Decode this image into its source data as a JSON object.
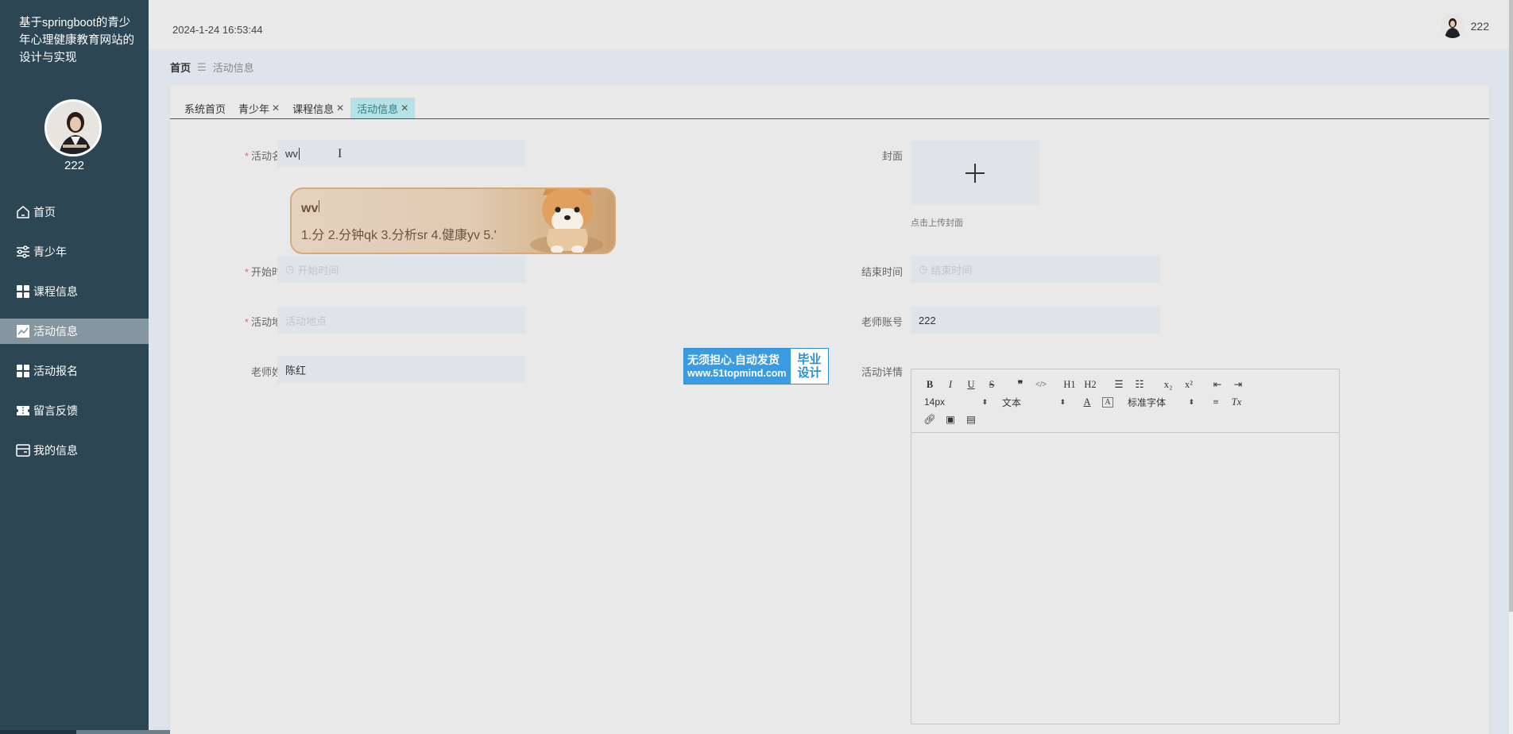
{
  "sidebar": {
    "system_title": "基于springboot的青少年心理健康教育网站的设计与实现",
    "username": "222",
    "menu": [
      {
        "label": "首页",
        "icon": "home-icon"
      },
      {
        "label": "青少年",
        "icon": "sliders-icon"
      },
      {
        "label": "课程信息",
        "icon": "grid-icon"
      },
      {
        "label": "活动信息",
        "icon": "chart-icon",
        "active": true
      },
      {
        "label": "活动报名",
        "icon": "grid-icon"
      },
      {
        "label": "留言反馈",
        "icon": "ticket-icon"
      },
      {
        "label": "我的信息",
        "icon": "card-icon"
      }
    ]
  },
  "header": {
    "datetime": "2024-1-24 16:53:44",
    "username": "222"
  },
  "breadcrumb": {
    "home": "首页",
    "current": "活动信息"
  },
  "tabs": [
    {
      "label": "系统首页",
      "closable": false
    },
    {
      "label": "青少年",
      "closable": true
    },
    {
      "label": "课程信息",
      "closable": true
    },
    {
      "label": "活动信息",
      "closable": true,
      "active": true
    }
  ],
  "form": {
    "activity_name": {
      "label": "活动名称",
      "value": "wv",
      "required": true
    },
    "start_time": {
      "label": "开始时间",
      "placeholder": "开始时间",
      "required": true
    },
    "location": {
      "label": "活动地点",
      "placeholder": "活动地点",
      "required": true
    },
    "teacher_name": {
      "label": "老师姓名",
      "value": "陈红"
    },
    "cover": {
      "label": "封面",
      "hint": "点击上传封面"
    },
    "end_time": {
      "label": "结束时间",
      "placeholder": "结束时间"
    },
    "teacher_account": {
      "label": "老师账号",
      "value": "222"
    },
    "details": {
      "label": "活动详情"
    }
  },
  "ime": {
    "composition": "wv",
    "candidates": "1.分  2.分钟qk  3.分析sr  4.健康yv  5.'"
  },
  "watermark": {
    "line1": "无须担心.自动发货",
    "line2": "www.51topmind.com",
    "right1": "毕业",
    "right2": "设计"
  },
  "editor": {
    "font_size": "14px",
    "paragraph": "文本",
    "font_family": "标准字体",
    "buttons": {
      "bold": "B",
      "italic": "I",
      "underline": "U",
      "strike": "S",
      "quote": "❞",
      "code": "</>",
      "h1": "H1",
      "h2": "H2",
      "subscript": "x₂",
      "superscript": "x²",
      "color": "A",
      "background": "A",
      "clear": "Tx"
    }
  }
}
